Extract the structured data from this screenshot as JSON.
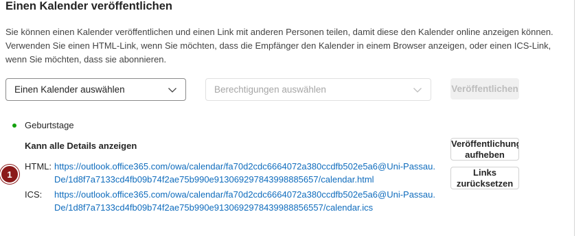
{
  "section": {
    "title": "Einen Kalender veröffentlichen",
    "description": "Sie können einen Kalender veröffentlichen und einen Link mit anderen Personen teilen, damit diese den Kalender online anzeigen können. Verwenden Sie einen HTML-Link, wenn Sie möchten, dass die Empfänger den Kalender in einem Browser anzeigen, oder einen ICS-Link, wenn Sie möchten, dass sie abonnieren."
  },
  "controls": {
    "calendar_select": "Einen Kalender auswählen",
    "permissions_select": "Berechtigungen auswählen",
    "publish_button": "Veröffentlichen"
  },
  "published": {
    "calendar_name": "Geburtstage",
    "status_color": "#13a10e",
    "permission": "Kann alle Details anzeigen",
    "html_label": "HTML:",
    "html_url": "https://outlook.office365.com/owa/calendar/fa70d2cdc6664072a380ccdfb502e5a6@Uni-Passau.De/1d8f7a7133cd4fb09b74f2ae75b990e913069297843998885657/calendar.html",
    "ics_label": "ICS:",
    "ics_url": "https://outlook.office365.com/owa/calendar/fa70d2cdc6664072a380ccdfb502e5a6@Uni-Passau.De/1d8f7a7133cd4fb09b74f2ae75b990e9130692978439988856557/calendar.ics",
    "unpublish_button": "Veröffentlichung aufheben",
    "reset_links_button": "Links zurücksetzen"
  },
  "annotation": {
    "badge_number": "1",
    "badge_color": "#8b1a1a"
  }
}
